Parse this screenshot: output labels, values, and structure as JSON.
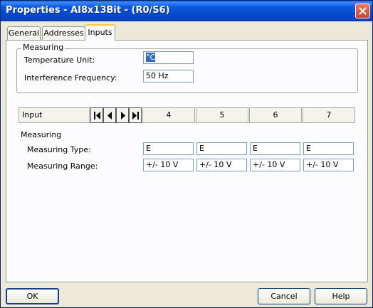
{
  "window": {
    "title": "Properties - AI8x13Bit - (R0/S6)"
  },
  "tabs": [
    {
      "label": "General"
    },
    {
      "label": "Addresses"
    },
    {
      "label": "Inputs"
    }
  ],
  "measuring_top": {
    "legend": "Measuring",
    "temperature_unit_label": "Temperature Unit:",
    "temperature_unit_value": "°C",
    "interference_frequency_label": "Interference Frequency:",
    "interference_frequency_value": "50 Hz"
  },
  "input_header": {
    "label": "Input",
    "channels": [
      "4",
      "5",
      "6",
      "7"
    ]
  },
  "measuring_channels": {
    "legend": "Measuring",
    "type_label": "Measuring Type:",
    "range_label": "Measuring Range:",
    "types": [
      "E",
      "E",
      "E",
      "E"
    ],
    "ranges": [
      "+/- 10 V",
      "+/- 10 V",
      "+/- 10 V",
      "+/- 10 V"
    ]
  },
  "buttons": {
    "ok": "OK",
    "cancel": "Cancel",
    "help": "Help"
  }
}
